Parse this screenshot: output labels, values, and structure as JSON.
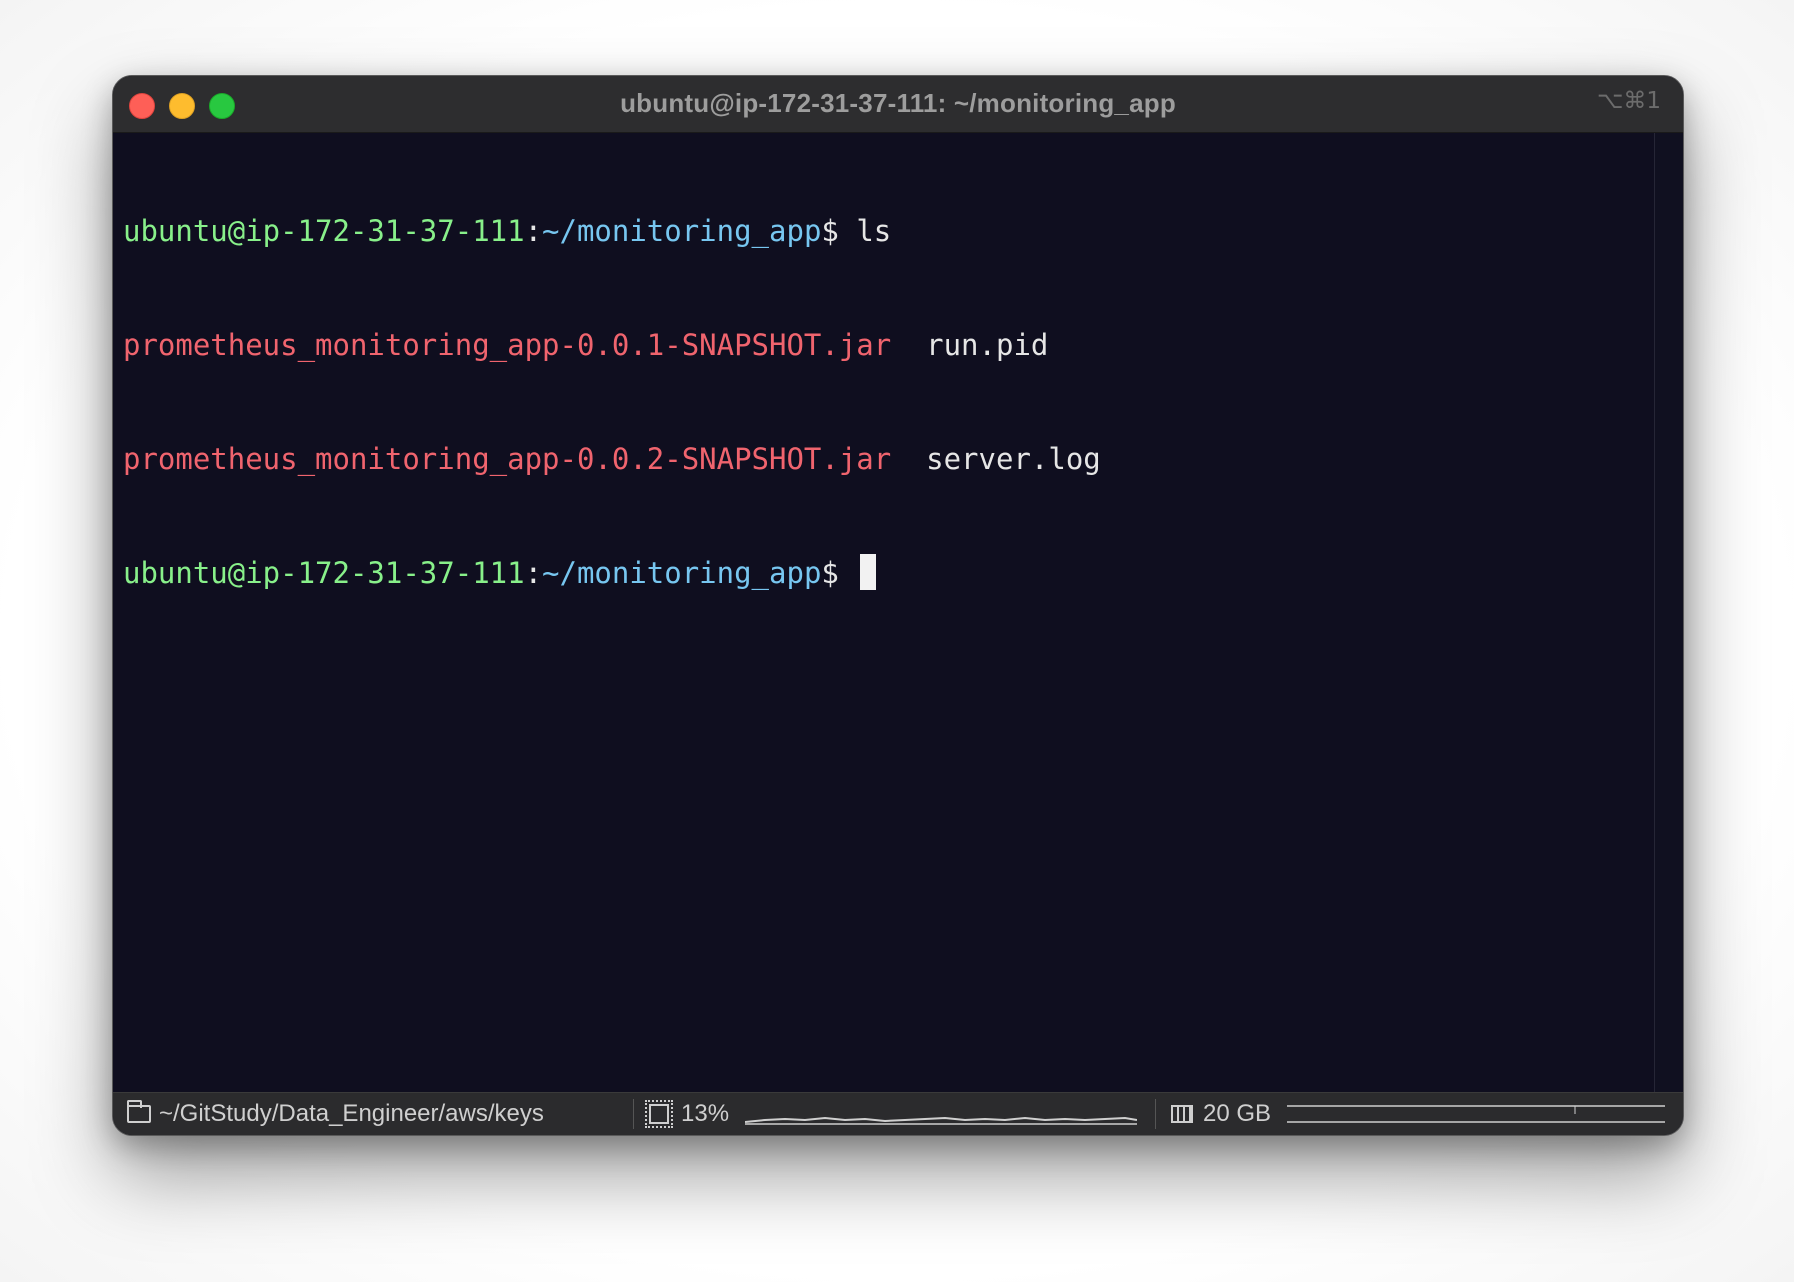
{
  "window": {
    "title": "ubuntu@ip-172-31-37-111: ~/monitoring_app",
    "shortcut": "⌥⌘1"
  },
  "terminal": {
    "prompt_user": "ubuntu@ip-172-31-37-111",
    "prompt_sep": ":",
    "prompt_path": "~/monitoring_app",
    "prompt_symbol": "$",
    "command": " ls",
    "ls_output": [
      {
        "jar": "prometheus_monitoring_app-0.0.1-SNAPSHOT.jar",
        "pad": "  ",
        "file": "run.pid"
      },
      {
        "jar": "prometheus_monitoring_app-0.0.2-SNAPSHOT.jar",
        "pad": "  ",
        "file": "server.log"
      }
    ]
  },
  "statusbar": {
    "cwd": "~/GitStudy/Data_Engineer/aws/keys",
    "cpu": "13%",
    "memory": "20 GB"
  },
  "colors": {
    "user": "#88f08a",
    "path": "#77c6f0",
    "jar": "#f0646e",
    "background": "#0f0e1f"
  }
}
